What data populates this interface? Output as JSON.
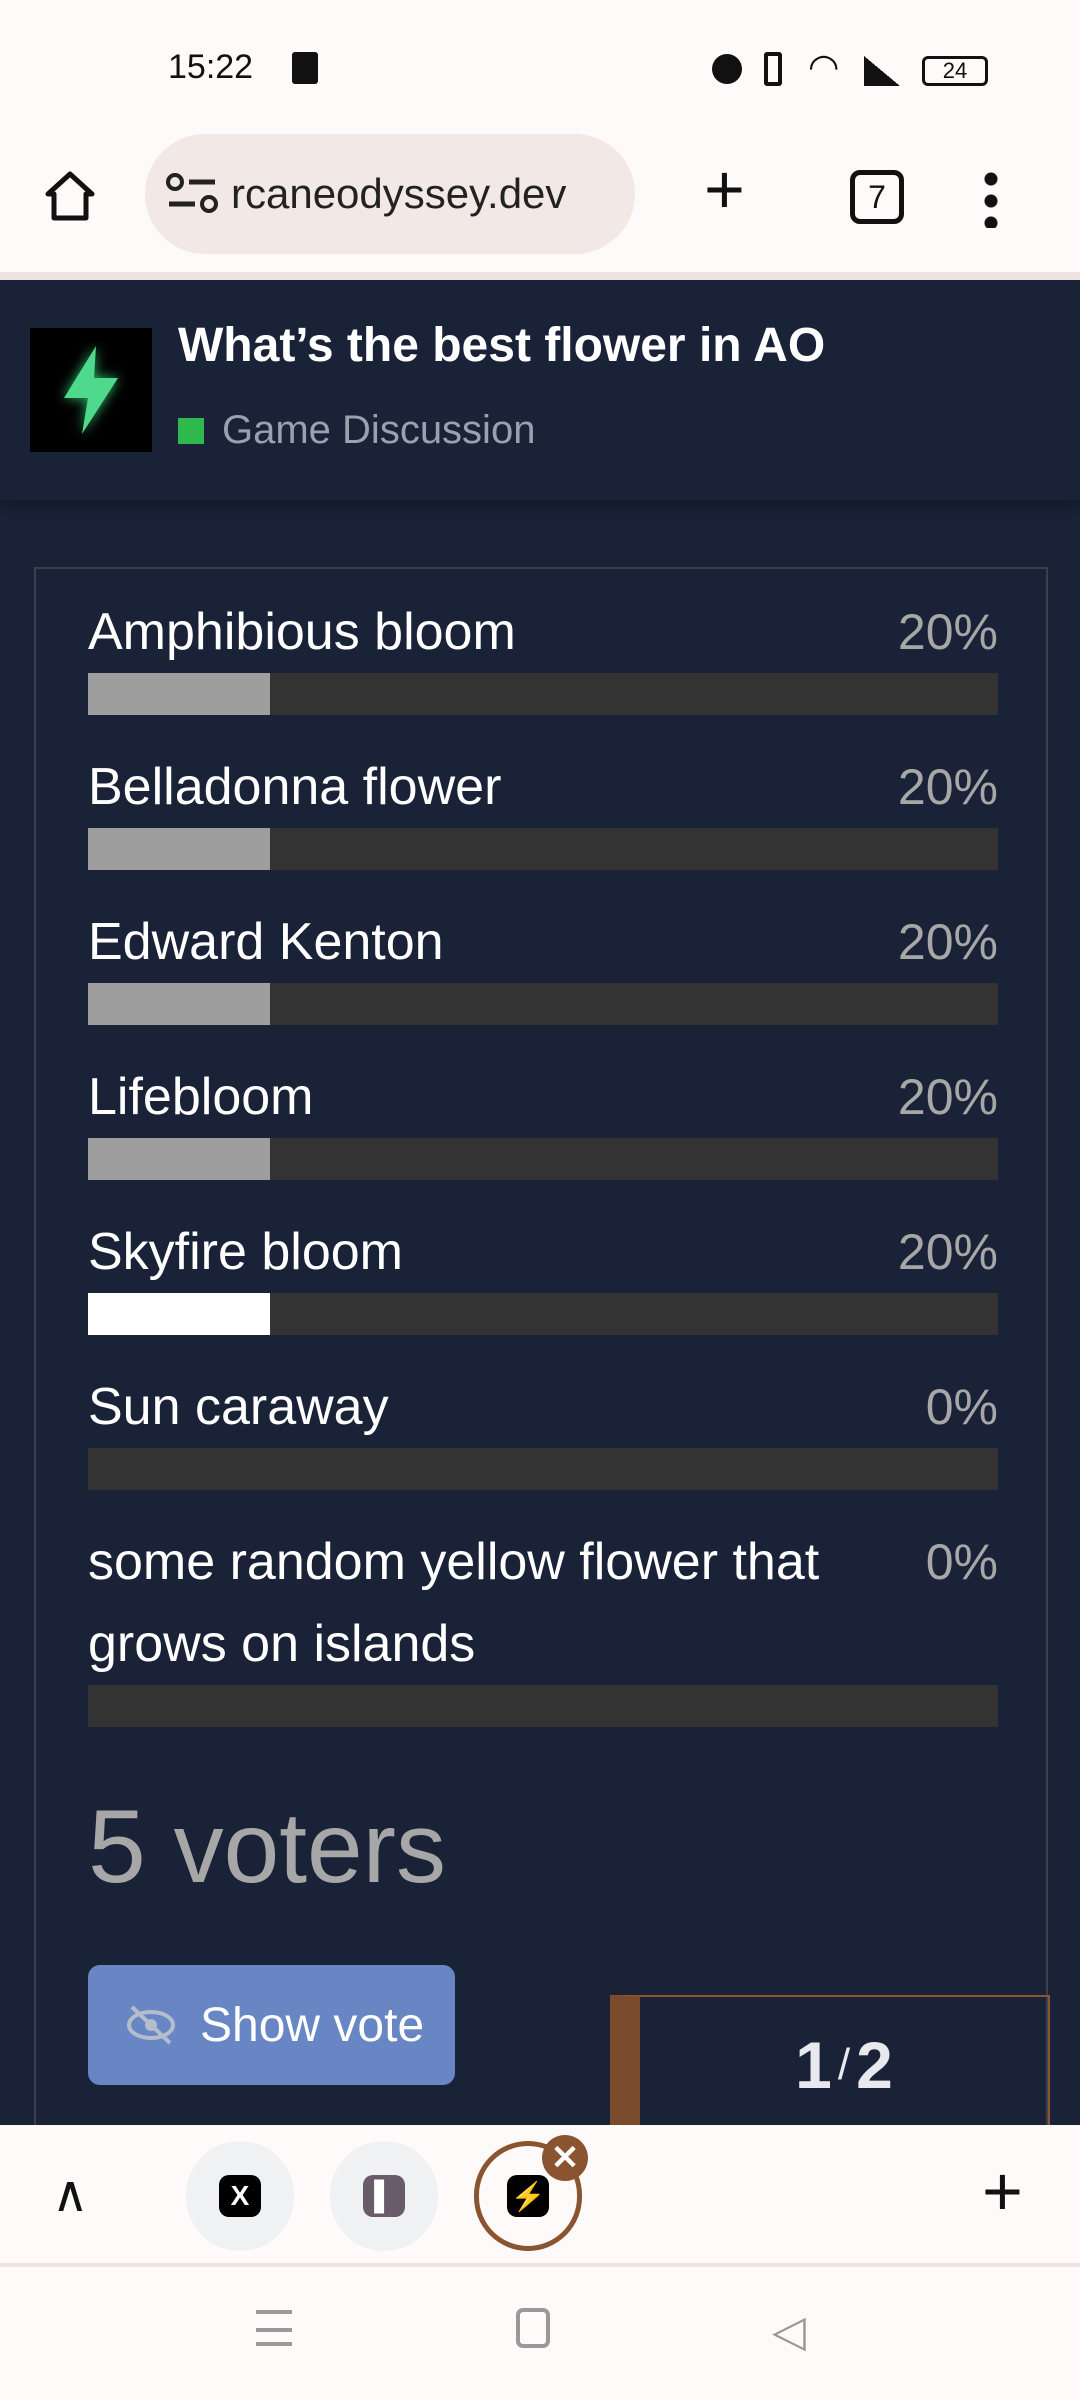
{
  "status_bar": {
    "time": "15:22",
    "battery": "24",
    "icons": [
      "shopping-bag-icon",
      "alarm-icon",
      "vibrate-icon",
      "wifi-icon",
      "signal-icon",
      "battery-icon"
    ]
  },
  "browser": {
    "url": "rcaneodyssey.dev",
    "tab_count": "7"
  },
  "topic": {
    "title": "What’s the best flower in AO",
    "category": "Game Discussion",
    "category_color": "#2fb84e"
  },
  "poll": {
    "options": [
      {
        "label": "Amphibious bloom",
        "percent": "20%",
        "value": 20
      },
      {
        "label": "Belladonna flower",
        "percent": "20%",
        "value": 20
      },
      {
        "label": "Edward Kenton",
        "percent": "20%",
        "value": 20
      },
      {
        "label": "Lifebloom",
        "percent": "20%",
        "value": 20
      },
      {
        "label": "Skyfire bloom",
        "percent": "20%",
        "value": 20,
        "highlighted": true
      },
      {
        "label": "Sun caraway",
        "percent": "0%",
        "value": 0
      },
      {
        "label": "some random yellow flower that grows on islands",
        "percent": "0%",
        "value": 0
      }
    ],
    "voters_count": "5",
    "voters_label": "voters",
    "show_vote_label": "Show vote"
  },
  "pager": {
    "current": "1",
    "total": "2",
    "sep": "/"
  },
  "colors": {
    "background": "#1a2238",
    "bar_fill": "#9e9e9e",
    "bar_selected": "#ffffff",
    "bar_track": "#333333",
    "button": "#6886c4",
    "accent": "#8a5431"
  }
}
